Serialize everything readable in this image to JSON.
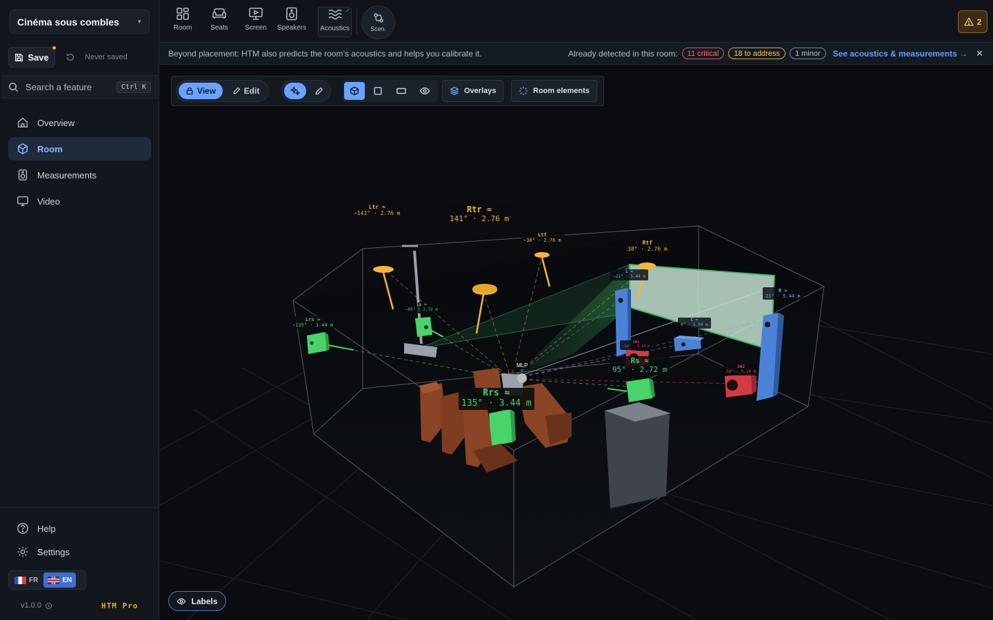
{
  "project": {
    "name": "Cinéma sous combles"
  },
  "save": {
    "label": "Save",
    "status": "Never saved"
  },
  "search": {
    "placeholder": "Search a feature",
    "shortcut": "Ctrl K"
  },
  "nav": {
    "items": [
      {
        "label": "Overview",
        "icon": "home-icon"
      },
      {
        "label": "Room",
        "icon": "cube-icon",
        "active": true
      },
      {
        "label": "Measurements",
        "icon": "speaker-icon"
      },
      {
        "label": "Video",
        "icon": "monitor-icon"
      }
    ]
  },
  "footer": {
    "help": "Help",
    "settings": "Settings",
    "lang_fr": "FR",
    "lang_en": "EN",
    "version": "v1.0.0",
    "tier": "HTM Pro"
  },
  "toolbar": {
    "tools": [
      {
        "label": "Room",
        "icon": "grid-icon"
      },
      {
        "label": "Seats",
        "icon": "sofa-icon"
      },
      {
        "label": "Screen",
        "icon": "screen-icon"
      },
      {
        "label": "Speakers",
        "icon": "speaker-icon"
      },
      {
        "label": "Acoustics",
        "icon": "waves-icon",
        "active": true
      }
    ],
    "scenarios": "Scen.",
    "alerts_count": "2"
  },
  "banner": {
    "text": "Beyond placement: HTM also predicts the room’s acoustics and helps you calibrate it.",
    "detected": "Already detected in this room:",
    "critical": "11 critical",
    "to_address": "18 to address",
    "minor": "1 minor",
    "link": "See acoustics & measurements →",
    "status_colors": {
      "critical": "#ff6b73",
      "to_address": "#ffc25c",
      "minor": "#b8c0cc"
    }
  },
  "viewport_toolbar": {
    "view": "View",
    "edit": "Edit",
    "overlays": "Overlays",
    "room_elements": "Room elements"
  },
  "labels_button": "Labels",
  "scene": {
    "mlp": "MLP",
    "speakers": [
      {
        "id": "Ltr",
        "name": "Ltr ≈",
        "value": "−141° · 2.76 m",
        "group": "height"
      },
      {
        "id": "Rtr",
        "name": "Rtr ≈",
        "value": "141° · 2.76 m",
        "group": "height"
      },
      {
        "id": "Ltf",
        "name": "Ltf",
        "value": "−38° · 2.76 m",
        "group": "height"
      },
      {
        "id": "Rtf",
        "name": "Rtf",
        "value": "38° · 2.76 m",
        "group": "height"
      },
      {
        "id": "L",
        "name": "L ≈",
        "value": "−21° · 5.44 m",
        "group": "front"
      },
      {
        "id": "R",
        "name": "R ≈",
        "value": "21° · 5.44 m",
        "group": "front"
      },
      {
        "id": "C",
        "name": "C ≈",
        "value": "0° · 5.04 m",
        "group": "front"
      },
      {
        "id": "SW1",
        "name": "SW1",
        "value": "−16° · 5.14 m",
        "group": "sub"
      },
      {
        "id": "SW2",
        "name": "SW2",
        "value": "16° · 5.14 m",
        "group": "sub"
      },
      {
        "id": "Lrs",
        "name": "Lrs ≈",
        "value": "−135° · 3.44 m",
        "group": "surround"
      },
      {
        "id": "Ls",
        "name": "Ls ≈",
        "value": "−95° · 2.72 m",
        "group": "surround"
      },
      {
        "id": "Rs",
        "name": "Rs ≈",
        "value": "95° · 2.72 m",
        "group": "surround"
      },
      {
        "id": "Rrs",
        "name": "Rrs ≈",
        "value": "135° · 3.44 m",
        "group": "surround"
      }
    ],
    "colors": {
      "height": "#f5b53a",
      "front": "#6aa3ff",
      "sub": "#e0454d",
      "surround": "#49d36b",
      "accent": "#6aa3ff"
    }
  }
}
